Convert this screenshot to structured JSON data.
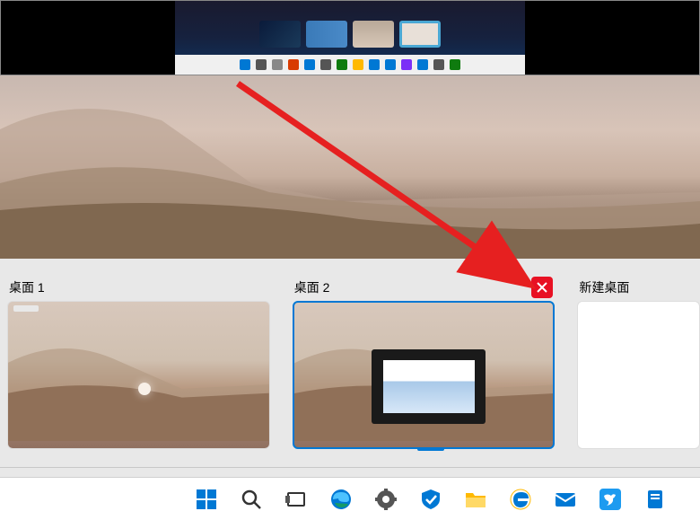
{
  "desktops": [
    {
      "label": "桌面 1",
      "has_close": false
    },
    {
      "label": "桌面 2",
      "has_close": true
    }
  ],
  "new_desktop_label": "新建桌面",
  "taskbar": {
    "icons": [
      "start",
      "search",
      "task-view",
      "edge",
      "settings",
      "security",
      "file-explorer",
      "edge-legacy",
      "mail",
      "bird-app",
      "files-app"
    ]
  },
  "colors": {
    "accent": "#0078d4",
    "close": "#e81123",
    "arrow": "#e62020"
  }
}
